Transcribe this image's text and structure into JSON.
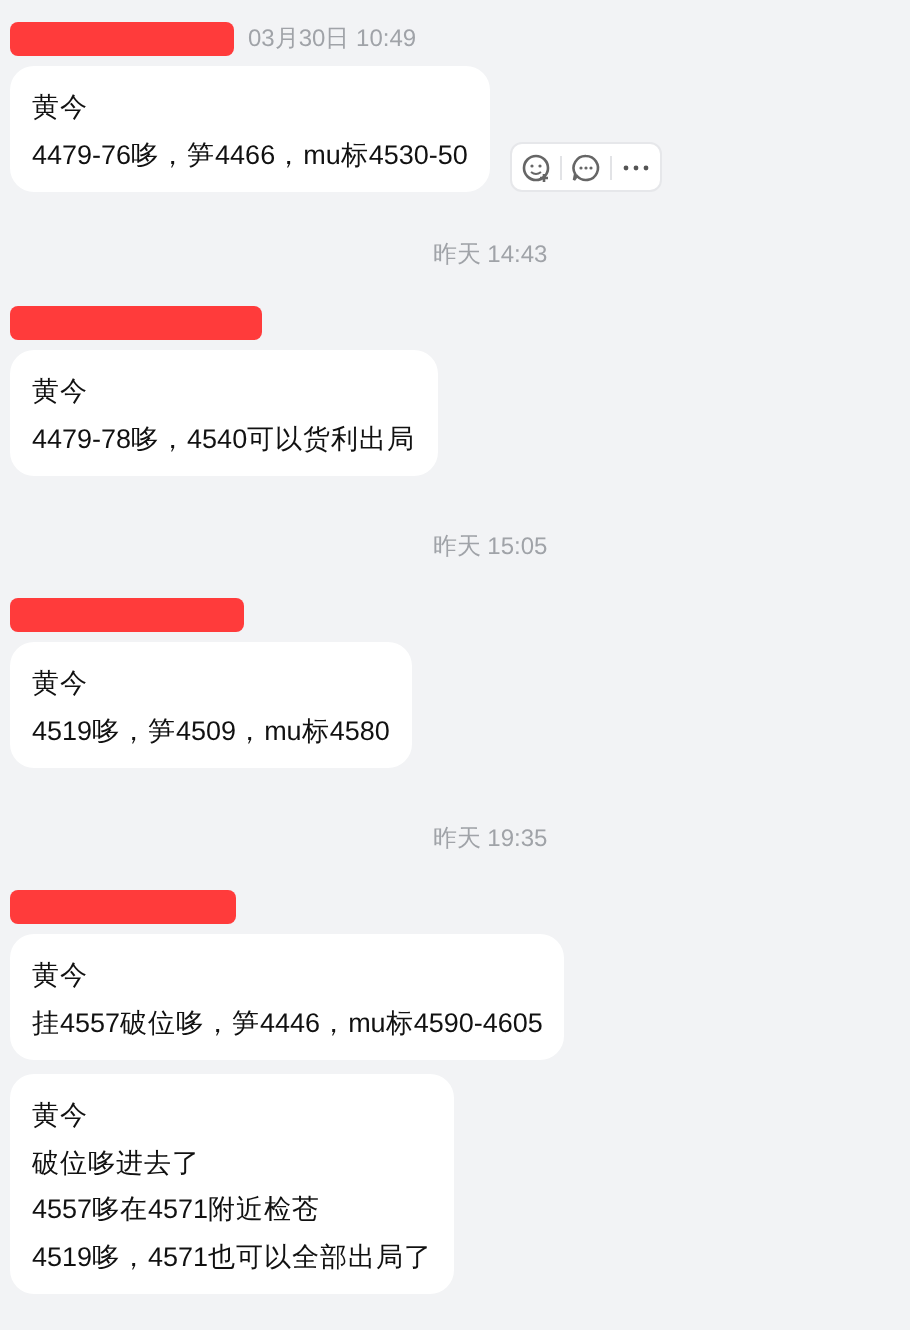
{
  "feed": [
    {
      "kind": "group",
      "time": "03月30日 10:49",
      "messages": [
        {
          "lines": [
            "黄今",
            "4479-76哆，笋4466，mu标4530-50"
          ],
          "hovered": true
        }
      ]
    },
    {
      "kind": "separator",
      "time": "昨天 14:43"
    },
    {
      "kind": "group",
      "messages": [
        {
          "lines": [
            "黄今",
            "4479-78哆，4540可以货利出局"
          ],
          "hovered": false
        }
      ]
    },
    {
      "kind": "separator",
      "time": "昨天 15:05"
    },
    {
      "kind": "group",
      "messages": [
        {
          "lines": [
            "黄今",
            "4519哆，笋4509，mu标4580"
          ],
          "hovered": false
        }
      ]
    },
    {
      "kind": "separator",
      "time": "昨天 19:35"
    },
    {
      "kind": "group",
      "messages": [
        {
          "lines": [
            "黄今",
            "挂4557破位哆，笋4446，mu标4590-4605"
          ],
          "hovered": false
        },
        {
          "lines": [
            "黄今",
            "破位哆进去了",
            "4557哆在4571附近检苍",
            "4519哆，4571也可以全部出局了"
          ],
          "hovered": false
        }
      ]
    }
  ]
}
